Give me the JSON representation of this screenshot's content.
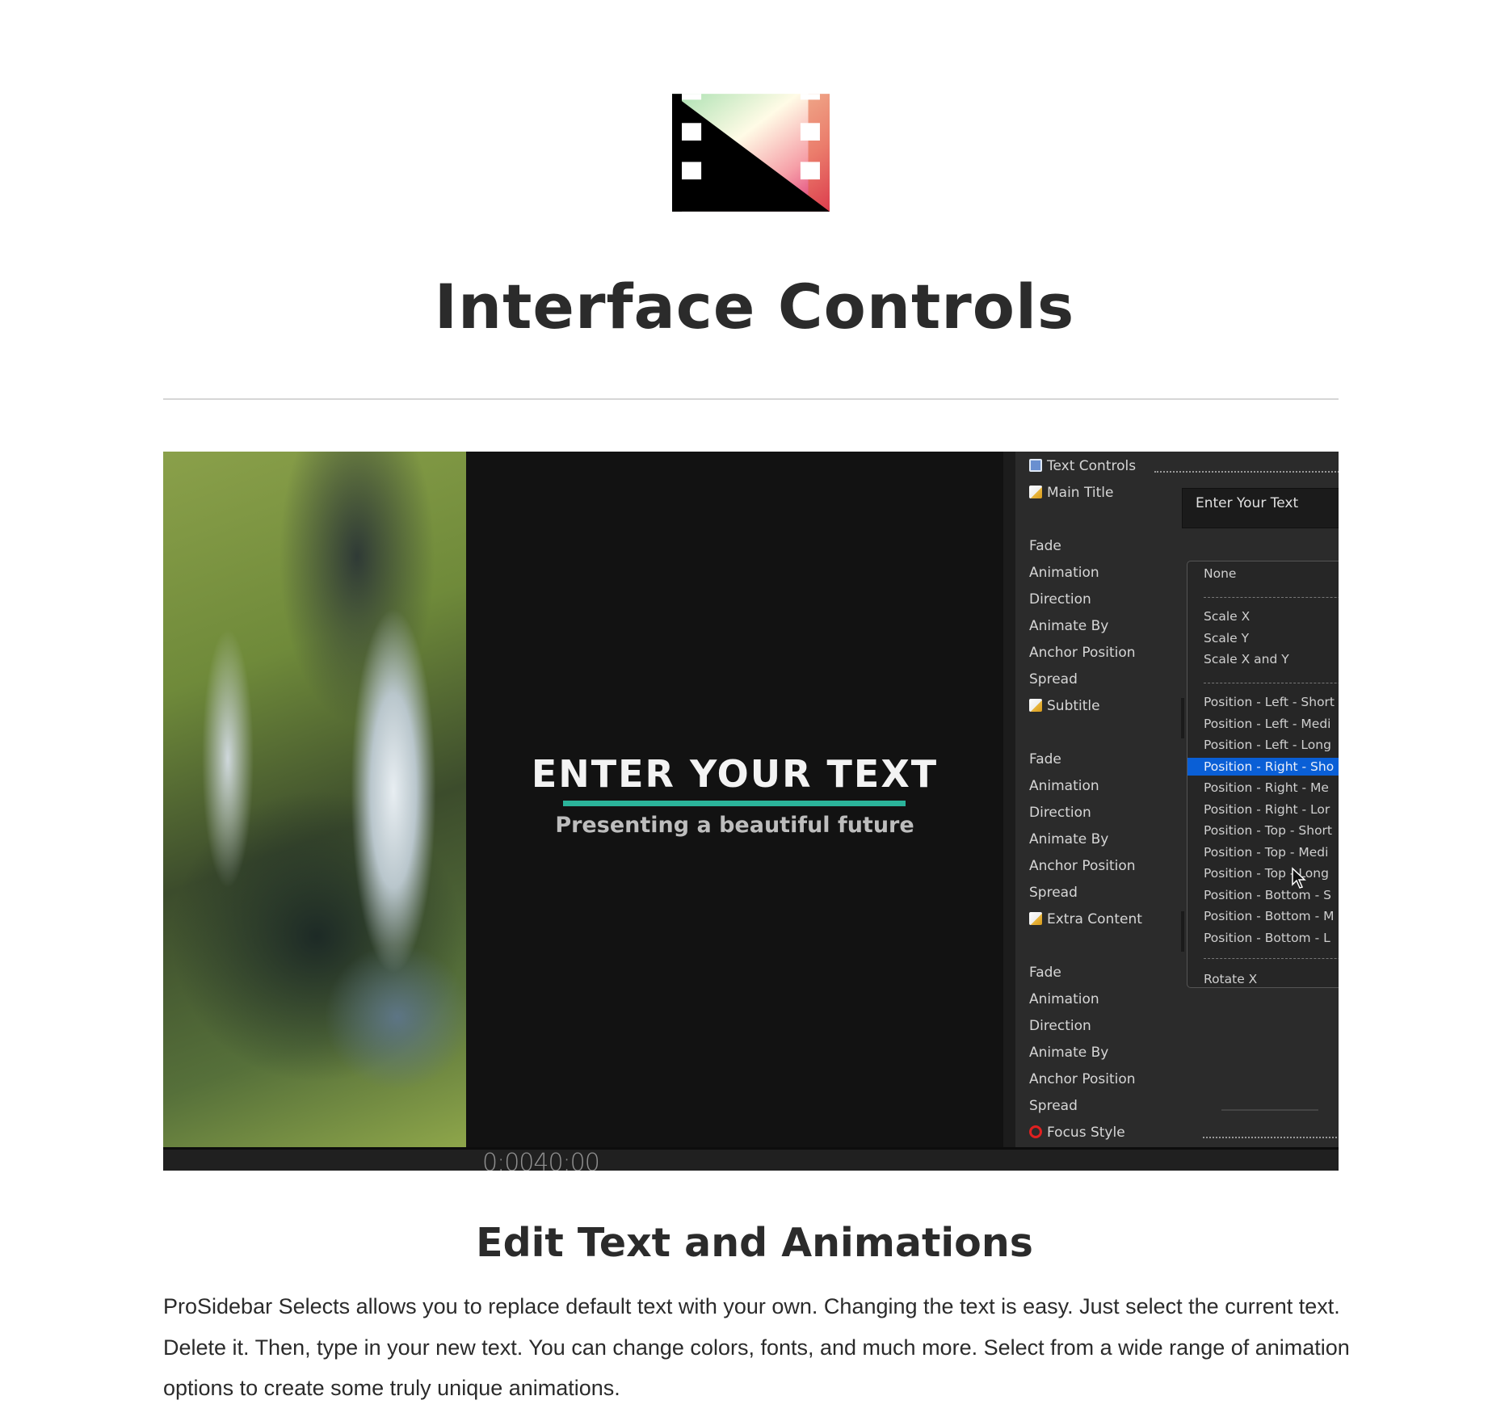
{
  "page": {
    "title": "Interface Controls",
    "section_heading": "Edit Text and Animations",
    "paragraph": "ProSidebar Selects allows you to replace default text with your own. Changing the text is easy. Just select the current text. Delete it. Then, type in your new text. You can change colors, fonts, and much more. Select from a wide range of animation options to create some truly unique animations."
  },
  "video": {
    "title_text": "ENTER YOUR TEXT",
    "subtitle_text": "Presenting a beautiful future",
    "accent_color": "#2bb39a",
    "timecode": "0:0040:00"
  },
  "panel": {
    "header": "Text Controls",
    "main_title_label": "Main Title",
    "main_title_value": "Enter Your Text",
    "subtitle_label": "Subtitle",
    "extra_label": "Extra Content",
    "focus_label": "Focus Style",
    "params": [
      "Fade",
      "Animation",
      "Direction",
      "Animate By",
      "Anchor Position",
      "Spread"
    ],
    "dropdown": {
      "selected_index": 7,
      "selected_color": "#0a5fd6",
      "options": [
        "None",
        "Scale X",
        "Scale Y",
        "Scale X and Y",
        "Position - Left - Short",
        "Position - Left - Medi",
        "Position - Left - Long",
        "Position - Right - Sho",
        "Position - Right - Me",
        "Position - Right - Lor",
        "Position - Top - Short",
        "Position - Top - Medi",
        "Position - Top - Long",
        "Position - Bottom - S",
        "Position - Bottom - M",
        "Position - Bottom - L",
        "Rotate X"
      ]
    }
  }
}
